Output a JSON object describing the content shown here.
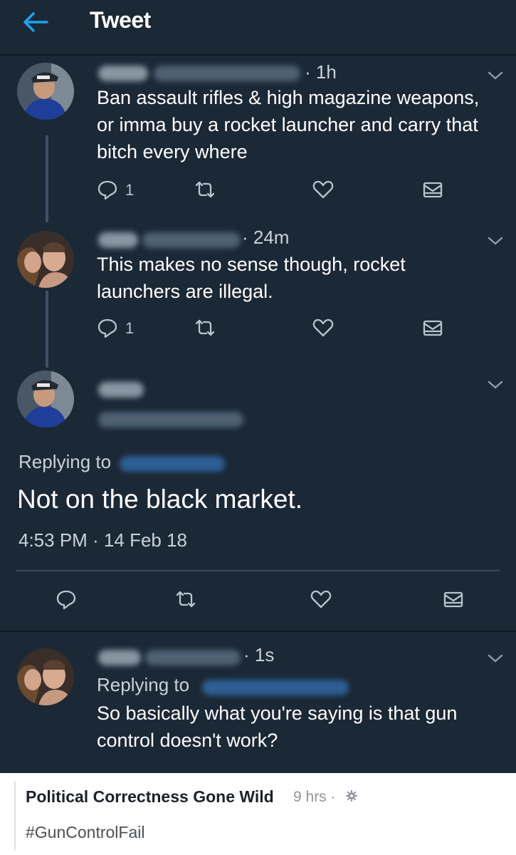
{
  "header": {
    "title": "Tweet"
  },
  "tweets": [
    {
      "time": "· 1h",
      "text_lines": [
        "Ban assault rifles & high magazine weapons,",
        "or imma buy a rocket launcher and carry that",
        "bitch every where"
      ],
      "reply_count": "1"
    },
    {
      "time": "· 24m",
      "text_lines": [
        "This makes no sense though, rocket",
        "launchers are illegal."
      ],
      "reply_count": "1"
    }
  ],
  "focused": {
    "replying_to": "Replying to",
    "text": "Not on the black market.",
    "datetime": "4:53 PM · 14 Feb 18"
  },
  "reply": {
    "time": "· 1s",
    "replying_to": "Replying to",
    "text_lines": [
      "So basically what you're saying is that gun",
      "control doesn't work?"
    ]
  },
  "facebook": {
    "page_name": "Political Correctness Gone Wild",
    "time": "9 hrs ·",
    "hashtag": "#GunControlFail"
  },
  "colors": {
    "background": "#1b2836",
    "accent": "#1da1f2",
    "icon": "#b8c4d0",
    "text": "#ffffff",
    "muted": "#c8d2dc"
  }
}
